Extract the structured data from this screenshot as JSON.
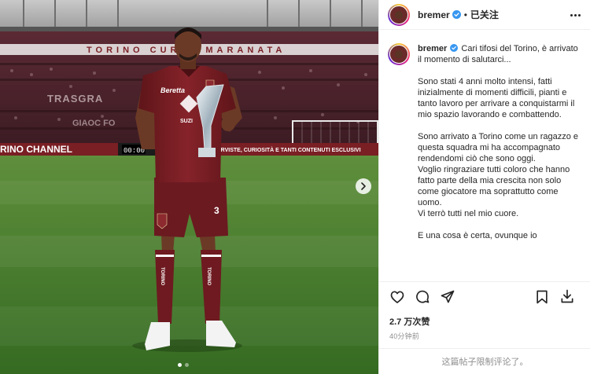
{
  "post": {
    "username": "bremer",
    "separator": "•",
    "follow_status": "已关注",
    "likes": "2.7 万次赞",
    "time": "40分钟前",
    "comments_limited": "这篇帖子限制评论了。",
    "carousel_total": 2,
    "carousel_index": 1
  },
  "caption": {
    "username": "bremer",
    "intro": "Cari tifosi del Torino, è arrivato il momento di salutarci...",
    "p1": "Sono stati 4 anni molto intensi, fatti inizialmente di momenti difficili, pianti e tanto lavoro per arrivare a conquistarmi il mio spazio lavorando e combattendo.",
    "p2": "Sono arrivato a Torino come un ragazzo e questa squadra mi ha accompagnato rendendomi ciò che sono oggi.",
    "p3": "Voglio ringraziare tutti coloro che hanno fatto parte della mia crescita non solo come giocatore ma soprattutto come uomo.",
    "p4": "Vi terrò tutti nel mio cuore.",
    "p5": "E una cosa è certa, ovunque io"
  },
  "photo": {
    "stand_banner": "TORINO CURVA MARANATA",
    "shirt_sponsor": "Beretta",
    "shirt_brand": "SUZI",
    "shorts_number": "3",
    "sock_text": "TORINO",
    "board_left": "RINO CHANNEL",
    "board_clock": "00:00",
    "board_right": "ERVISTE, CURIOSITÀ E TANTI CONTENUTI ESCLUSIVI",
    "stand_text_2": "TRASGRA",
    "stand_text_3": "GIAOC FO"
  },
  "icons": {
    "verified": "verified-badge-icon",
    "more": "more-options-icon",
    "like": "heart-icon",
    "comment": "comment-icon",
    "share": "share-icon",
    "save": "bookmark-icon",
    "download": "download-icon",
    "next": "chevron-right-icon"
  },
  "colors": {
    "verified_blue": "#3897f0",
    "kit_maroon": "#7a1f24",
    "pitch_green": "#3f7a2b",
    "muted_text": "#8e8e8e"
  }
}
